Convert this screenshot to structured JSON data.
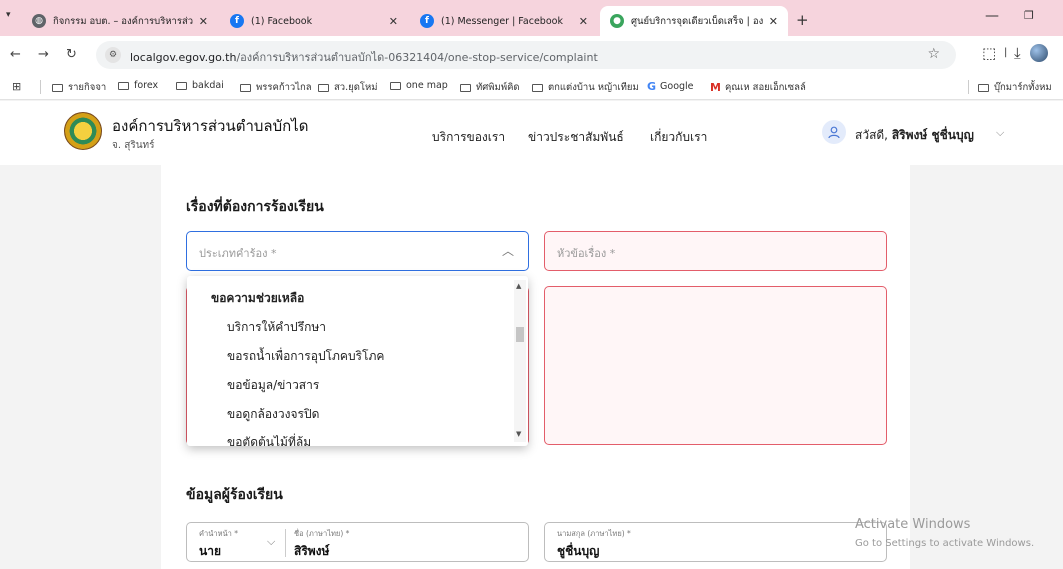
{
  "browser": {
    "tabs": [
      {
        "title": "กิจกรรม อบต. – องค์การบริหารส่วนตำ",
        "icon": "globe-icon",
        "color": "#5f6368"
      },
      {
        "title": "(1) Facebook",
        "icon": "facebook-icon",
        "color": "#1877f2"
      },
      {
        "title": "(1) Messenger | Facebook",
        "icon": "facebook-icon",
        "color": "#1877f2"
      },
      {
        "title": "ศูนย์บริการจุดเดียวเบ็ดเสร็จ | องค์การ",
        "icon": "site-icon",
        "color": "#3aa55d"
      }
    ],
    "active_tab": 3,
    "url_host": "localgov.egov.go.th",
    "url_path": "/องค์การบริหารส่วนตำบลบักได-06321404/one-stop-service/complaint",
    "bookmarks": [
      "รายกิจจา",
      "forex",
      "bakdai",
      "พรรคก้าวไกล",
      "สว.ยุดโหม่",
      "one map",
      "ทัศพิมพ์คิด",
      "ตกแต่งบ้าน หญ้าเทียม",
      "Google",
      "คุณเห สอยเอ็กเซลล์"
    ],
    "bookmarks_other": "บุ๊กมาร์กทั้งหม"
  },
  "site": {
    "org_name": "องค์การบริหารส่วนตำบลบักได",
    "org_province": "จ. สุรินทร์",
    "nav": [
      "บริการของเรา",
      "ข่าวประชาสัมพันธ์",
      "เกี่ยวกับเรา"
    ],
    "greeting": "สวัสดี,",
    "user_name": "สิริพงษ์ ชูชื่นบุญ"
  },
  "form": {
    "section1_title": "เรื่องที่ต้องการร้องเรียน",
    "type_placeholder": "ประเภทคำร้อง *",
    "subject_placeholder": "หัวข้อเรื่อง *",
    "dropdown": {
      "group": "ขอความช่วยเหลือ",
      "items": [
        "บริการให้คำปรึกษา",
        "ขอรถน้ำเพื่อการอุปโภคบริโภค",
        "ขอข้อมูล/ข่าวสาร",
        "ขอดูกล้องวงจรปิด",
        "ขอตัดต้นไม้ที่ล้ม"
      ]
    },
    "section2_title": "ข้อมูลผู้ร้องเรียน",
    "prefix_label": "คำนำหน้า *",
    "prefix_value": "นาย",
    "firstname_label": "ชื่อ (ภาษาไทย) *",
    "firstname_value": "สิริพงษ์",
    "lastname_label": "นามสกุล (ภาษาไทย) *",
    "lastname_value": "ชูชื่นบุญ"
  },
  "watermark": {
    "line1": "Activate Windows",
    "line2": "Go to Settings to activate Windows."
  }
}
